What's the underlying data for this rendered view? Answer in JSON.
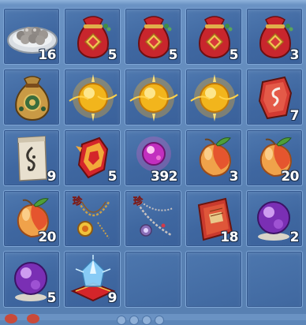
{
  "inventory": {
    "slots": [
      {
        "item": "rice-dumpling-plate-icon",
        "count": "16"
      },
      {
        "item": "red-lucky-bag-icon",
        "count": "5"
      },
      {
        "item": "red-lucky-bag-icon",
        "count": "5"
      },
      {
        "item": "red-lucky-bag-icon",
        "count": "5"
      },
      {
        "item": "red-lucky-bag-icon",
        "count": "3"
      },
      {
        "item": "gold-treasure-bag-icon",
        "count": ""
      },
      {
        "item": "glowing-gold-orb-icon",
        "count": ""
      },
      {
        "item": "glowing-gold-orb-icon",
        "count": ""
      },
      {
        "item": "glowing-gold-orb-icon",
        "count": ""
      },
      {
        "item": "red-rune-stone-icon",
        "count": "7"
      },
      {
        "item": "scroll-talisman-icon",
        "count": "9"
      },
      {
        "item": "red-charm-token-icon",
        "count": "5"
      },
      {
        "item": "pink-spirit-gem-icon",
        "count": "392"
      },
      {
        "item": "peach-icon",
        "count": "3"
      },
      {
        "item": "peach-icon",
        "count": "20"
      },
      {
        "item": "peach-icon",
        "count": "20"
      },
      {
        "item": "gold-amulet-necklace-icon",
        "count": ""
      },
      {
        "item": "silver-gem-necklace-icon",
        "count": ""
      },
      {
        "item": "red-book-icon",
        "count": "18"
      },
      {
        "item": "purple-orb-icon",
        "count": "2"
      },
      {
        "item": "purple-orb-icon",
        "count": "5"
      },
      {
        "item": "crystal-on-cushion-icon",
        "count": "9"
      },
      {
        "item": "",
        "count": ""
      },
      {
        "item": "",
        "count": ""
      },
      {
        "item": "",
        "count": ""
      }
    ],
    "rare_mark": "珍"
  }
}
